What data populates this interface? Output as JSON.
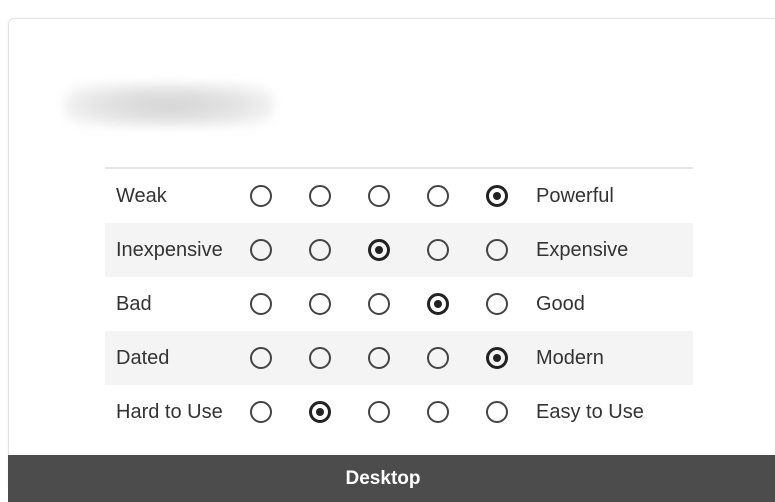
{
  "matrix": {
    "rows": [
      {
        "left": "Weak",
        "right": "Powerful",
        "selected": 5
      },
      {
        "left": "Inexpensive",
        "right": "Expensive",
        "selected": 3
      },
      {
        "left": "Bad",
        "right": "Good",
        "selected": 4
      },
      {
        "left": "Dated",
        "right": "Modern",
        "selected": 5
      },
      {
        "left": "Hard to Use",
        "right": "Easy to Use",
        "selected": 2
      }
    ]
  },
  "device_bar": {
    "label": "Desktop"
  }
}
